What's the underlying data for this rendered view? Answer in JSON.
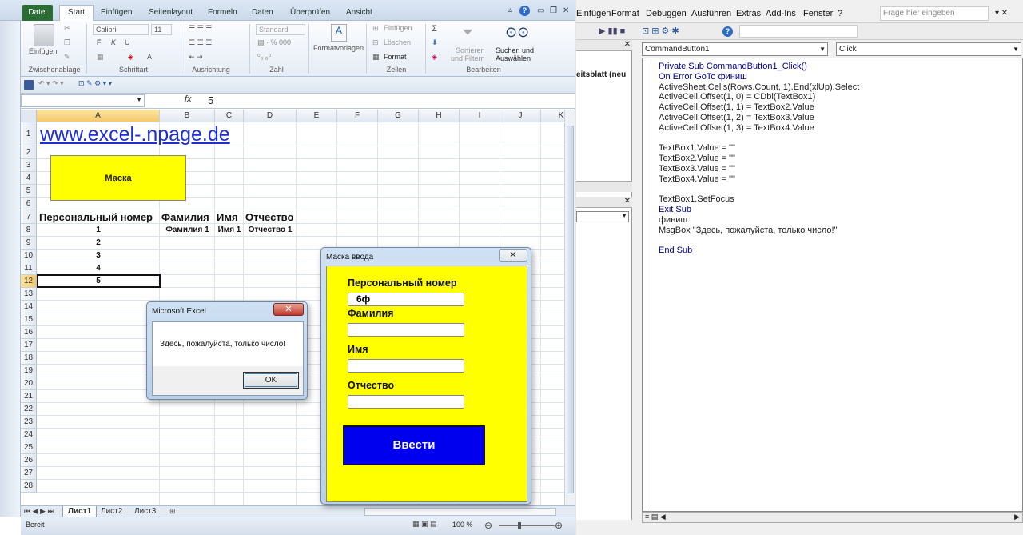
{
  "excel": {
    "file_tab": "Datei",
    "tabs": [
      "Start",
      "Einfügen",
      "Seitenlayout",
      "Formeln",
      "Daten",
      "Überprüfen",
      "Ansicht"
    ],
    "ribbon": {
      "paste": "Einfügen",
      "clipboard": "Zwischenablage",
      "font_name": "Calibri",
      "font_size": "11",
      "font_group": "Schriftart",
      "align_group": "Ausrichtung",
      "number_format": "Standard",
      "number_group": "Zahl",
      "format_templates": "Formatvorlagen",
      "insert_cells": "Einfügen",
      "delete_cells": "Löschen",
      "format_cells": "Format",
      "cells_group": "Zellen",
      "sort_filter_1": "Sortieren",
      "sort_filter_2": "und Filtern",
      "find_1": "Suchen und",
      "find_2": "Auswählen",
      "edit_group": "Bearbeiten",
      "bold": "F",
      "italic": "K",
      "underline": "U"
    },
    "formula_bar": {
      "fx": "fx",
      "value": "5"
    },
    "columns": [
      "A",
      "B",
      "C",
      "D",
      "E",
      "F",
      "G",
      "H",
      "I",
      "J",
      "K"
    ],
    "rows": [
      "1",
      "2",
      "3",
      "4",
      "5",
      "6",
      "7",
      "8",
      "9",
      "10",
      "11",
      "12",
      "13",
      "14",
      "15",
      "16",
      "17",
      "18",
      "19",
      "20",
      "21",
      "22",
      "23",
      "24",
      "25",
      "26",
      "27",
      "28"
    ],
    "cells": {
      "url": "www.excel-.npage.de",
      "mask_button": "Маска",
      "h_personal": "Персональный номер",
      "h_family": "Фамилия",
      "h_name": "Имя",
      "h_patronymic": "Отчество",
      "r8_a": "1",
      "r8_b": "Фамилия 1",
      "r8_c": "Имя 1",
      "r8_d": "Отчество 1",
      "r9_a": "2",
      "r10_a": "3",
      "r11_a": "4",
      "r12_a": "5"
    },
    "sheets": [
      "Лист1",
      "Лист2",
      "Лист3"
    ],
    "status": {
      "ready": "Bereit",
      "zoom": "100 %"
    }
  },
  "vba": {
    "menu": [
      "Einfügen",
      "Format",
      "Debuggen",
      "Ausführen",
      "Extras",
      "Add-Ins",
      "Fenster",
      "?"
    ],
    "help_placeholder": "Frage hier eingeben",
    "object_combo": "CommandButton1",
    "proc_combo": "Click",
    "project_fragment": "eitsblatt (neu",
    "code": [
      "Private Sub CommandButton1_Click()",
      "On Error GoTo финиш",
      "ActiveSheet.Cells(Rows.Count, 1).End(xlUp).Select",
      "ActiveCell.Offset(1, 0) = CDbl(TextBox1)",
      "ActiveCell.Offset(1, 1) = TextBox2.Value",
      "ActiveCell.Offset(1, 2) = TextBox3.Value",
      "ActiveCell.Offset(1, 3) = TextBox4.Value",
      "",
      "TextBox1.Value = \"\"",
      "TextBox2.Value = \"\"",
      "TextBox3.Value = \"\"",
      "TextBox4.Value = \"\"",
      "",
      "TextBox1.SetFocus",
      "Exit Sub",
      "финиш:",
      "MsgBox \"Здесь, пожалуйста, только число!\"",
      "",
      "End Sub"
    ]
  },
  "msgbox": {
    "title": "Microsoft Excel",
    "text": "Здесь, пожалуйста, только число!",
    "ok": "OK",
    "close": "✕"
  },
  "userform": {
    "title": "Маска ввода",
    "close": "✕",
    "label1": "Персональный номер",
    "value1": "6ф",
    "label2": "Фамилия",
    "label3": "Имя",
    "label4": "Отчество",
    "submit": "Ввести",
    "bg_color": "#ffff00",
    "button_color": "#0000ee"
  }
}
